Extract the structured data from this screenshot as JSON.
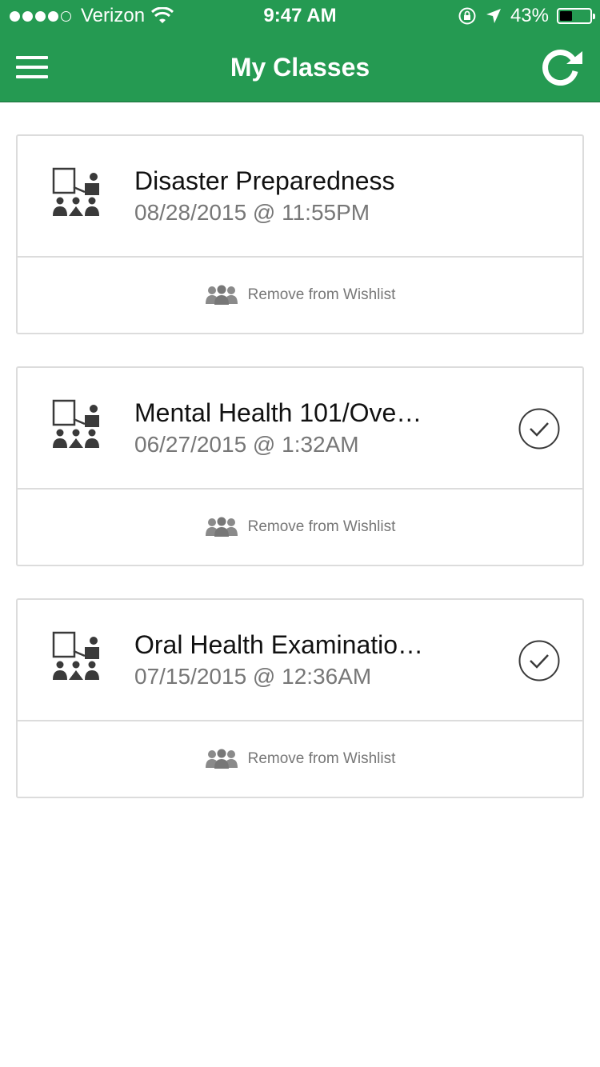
{
  "status_bar": {
    "carrier": "Verizon",
    "signal_bars": 4,
    "signal_max": 5,
    "time": "9:47 AM",
    "battery_percent": "43%",
    "battery_level": 0.43,
    "icons": [
      "wifi-icon",
      "rotation-lock-icon",
      "location-arrow-icon",
      "battery-icon"
    ]
  },
  "nav": {
    "title": "My Classes",
    "left_icon": "hamburger-menu-icon",
    "right_icon": "refresh-icon"
  },
  "classes": [
    {
      "title": "Disaster Preparedness",
      "date": "08/28/2015 @ 11:55PM",
      "completed": false,
      "action_label": "Remove from Wishlist"
    },
    {
      "title": "Mental Health 101/Ove…",
      "date": "06/27/2015 @ 1:32AM",
      "completed": true,
      "action_label": "Remove from Wishlist"
    },
    {
      "title": "Oral Health Examinatio…",
      "date": "07/15/2015 @ 12:36AM",
      "completed": true,
      "action_label": "Remove from Wishlist"
    }
  ],
  "colors": {
    "brand_green": "#259a52",
    "card_border": "#dcdcdc",
    "secondary_text": "#777777"
  }
}
